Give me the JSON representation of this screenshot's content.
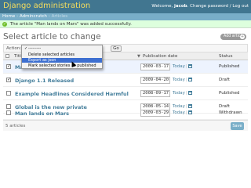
{
  "header": {
    "brand": "Django administration",
    "welcome": "Welcome,",
    "username": "jacob",
    "change_password": "Change password",
    "separator": "/",
    "logout": "Log out"
  },
  "breadcrumbs": [
    "Home",
    "Admincrutch",
    "Articles"
  ],
  "message": "The article \"Man lands on Mars\" was added successfully.",
  "page_title": "Select article to change",
  "add_button": "Add article",
  "actions": {
    "label": "Action:",
    "go": "Go",
    "options": [
      {
        "label": "---------",
        "checked": true
      },
      {
        "label": "Delete selected articles"
      },
      {
        "label": "Export as json",
        "selected": true
      },
      {
        "label": "Mark selected stories as published"
      }
    ]
  },
  "table": {
    "columns": [
      "Title",
      "Publication date",
      "Status"
    ],
    "today_label": "Today",
    "rows": [
      {
        "title": "Man lands on Mars",
        "date": "2009-03-17",
        "status": "Published",
        "checked": true
      },
      {
        "title": "Django 1.1 Released",
        "date": "2009-04-20",
        "status": "Draft",
        "checked": true
      },
      {
        "title": "Example Headlines Considered Harmful",
        "date": "2008-09-17",
        "status": "Published",
        "checked": false
      },
      {
        "title": "Global is the new private",
        "date": "2008-05-14",
        "status": "Draft",
        "checked": false
      },
      {
        "title": "Man lands on Mars",
        "date": "2009-03-29",
        "status": "Withdrawn",
        "checked": false
      }
    ]
  },
  "paginator": "5 articles",
  "save_button": "Save",
  "colors": {
    "header_bg": "#417690",
    "breadcrumb_bg": "#79aec8",
    "brand_yellow": "#f5dd5d",
    "success_bg": "#ddffdd",
    "link": "#447e9b",
    "row_alt": "#edf3fe",
    "selection": "#3d6fd0"
  }
}
